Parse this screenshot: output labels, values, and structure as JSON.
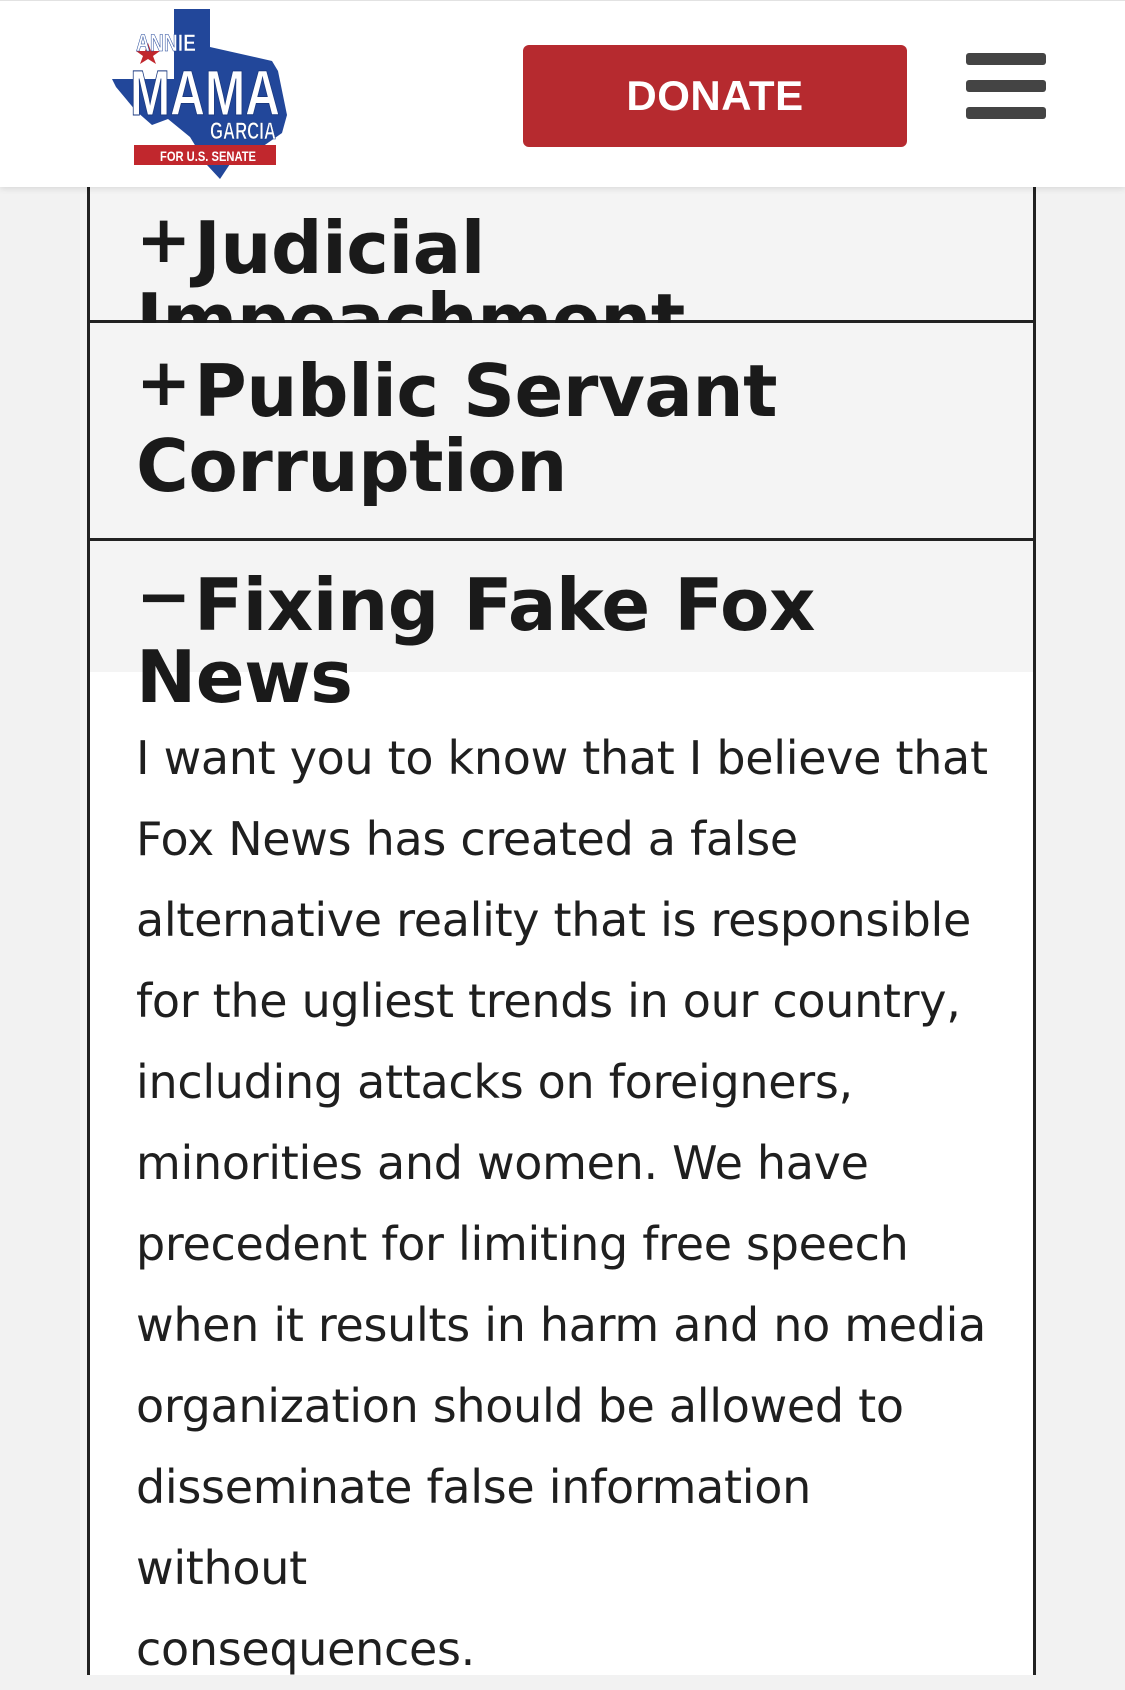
{
  "header": {
    "logo": {
      "line_top": "ANNIE",
      "line_main": "MAMA",
      "line_name": "GARCIA",
      "line_banner": "FOR U.S. SENATE"
    },
    "donate_label": "DONATE",
    "menu_icon": "hamburger-menu-icon"
  },
  "accordion": {
    "items": [
      {
        "sign": "+",
        "title_lines": [
          "Judicial Impeachment"
        ],
        "expanded": false
      },
      {
        "sign": "+",
        "title_lines": [
          "Public Servant",
          "Corruption"
        ],
        "expanded": false
      },
      {
        "sign": "−",
        "title_lines": [
          "Fixing Fake Fox News"
        ],
        "expanded": true
      }
    ],
    "expanded_body_lines": [
      "I want you to know that I believe that",
      "Fox News has created a false",
      "alternative reality that is responsible",
      "for the ugliest trends in our country,",
      "including attacks on foreigners,",
      "minorities and women. We have",
      "precedent for limiting free speech",
      "when it results in harm and no media",
      "organization should be allowed to",
      "disseminate false information without",
      "consequences."
    ]
  },
  "colors": {
    "brand_red": "#b62a2f",
    "brand_blue": "#22479a",
    "text_dark": "#1a1a1a",
    "page_bg": "#f2f2f2"
  }
}
